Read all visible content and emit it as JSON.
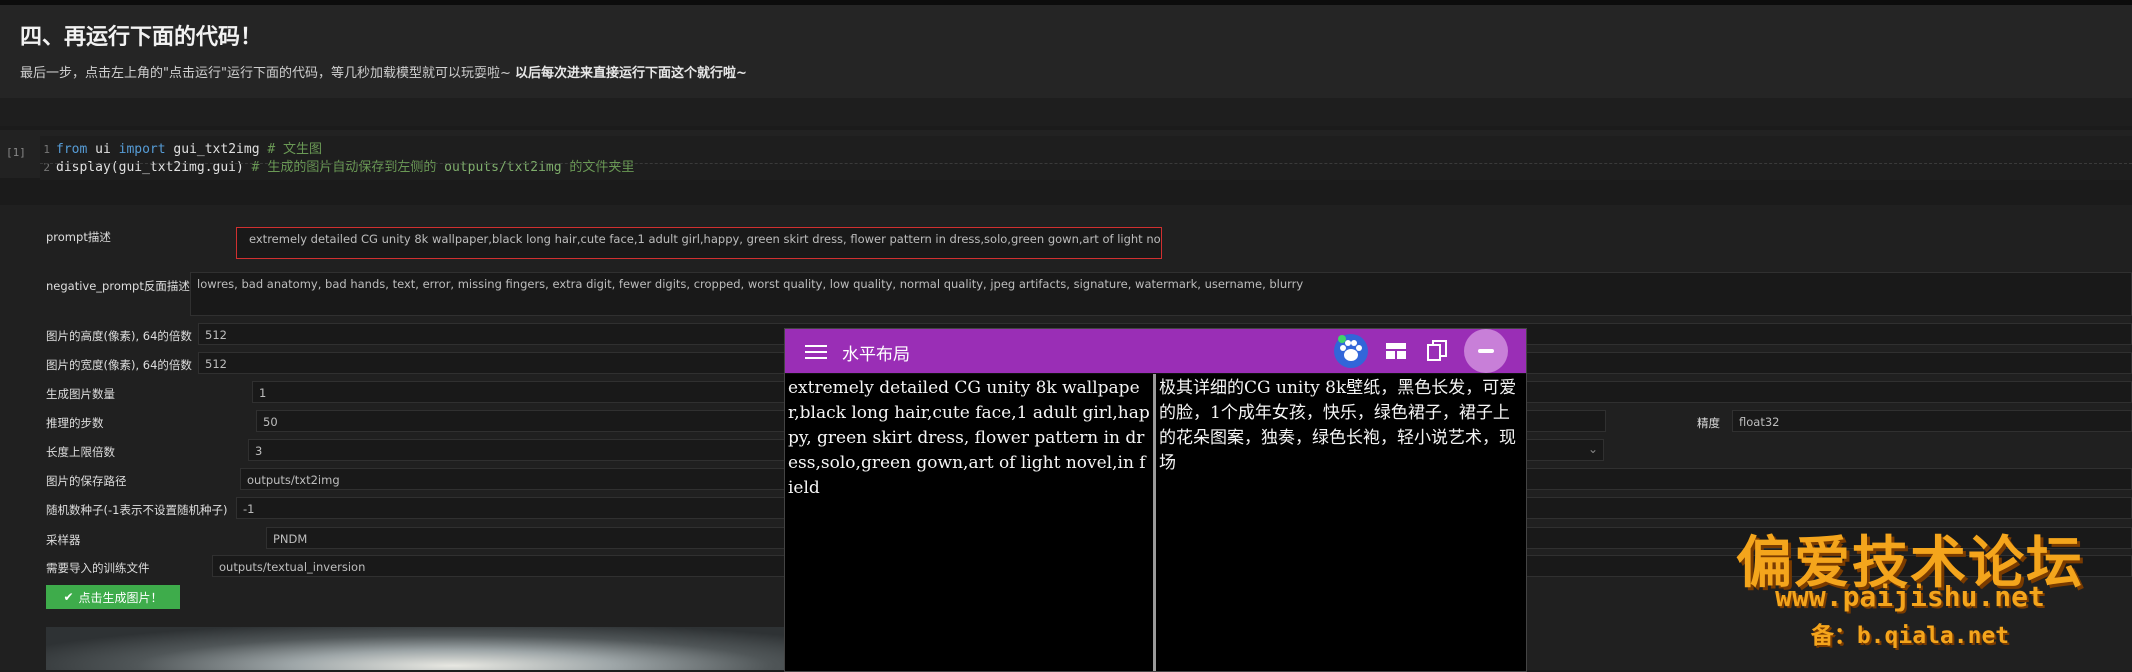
{
  "markdown": {
    "title": "四、再运行下面的代码！",
    "text": "最后一步，点击左上角的\"点击运行\"运行下面的代码，等几秒加载模型就可以玩耍啦~",
    "text_bold": "以后每次进来直接运行下面这个就行啦~"
  },
  "code_cell": {
    "exec_count": "[1]",
    "line1": {
      "num": "1",
      "kw1": "from",
      "mod": "ui",
      "kw2": "import",
      "name": "gui_txt2img",
      "comment": "# 文生图"
    },
    "line2": {
      "num": "2",
      "code": "display(gui_txt2img.gui)",
      "comment": "# 生成的图片自动保存到左侧的",
      "path": "outputs/txt2img",
      "comment2": "的文件夹里"
    }
  },
  "form": {
    "prompt": {
      "label": "prompt描述",
      "value": "extremely detailed CG unity 8k wallpaper,black long hair,cute face,1 adult girl,happy, green skirt dress, flower pattern in dress,solo,green gown,art of light novel,in field"
    },
    "negative_prompt": {
      "label": "negative_prompt反面描述",
      "value": "lowres, bad anatomy, bad hands, text, error, missing fingers, extra digit, fewer digits, cropped, worst quality, low quality, normal quality, jpeg artifacts, signature, watermark, username, blurry"
    },
    "height": {
      "label": "图片的高度(像素), 64的倍数",
      "value": "512"
    },
    "width": {
      "label": "图片的宽度(像素), 64的倍数",
      "value": "512"
    },
    "num_images": {
      "label": "生成图片数量",
      "value": "1"
    },
    "steps": {
      "label": "推理的步数",
      "value": "50"
    },
    "precision": {
      "label": "精度",
      "value": "float32"
    },
    "max_len": {
      "label": "长度上限倍数",
      "value": "3"
    },
    "save_path": {
      "label": "图片的保存路径",
      "value": "outputs/txt2img"
    },
    "seed": {
      "label": "随机数种子(-1表示不设置随机种子)",
      "value": "-1"
    },
    "sampler": {
      "label": "采样器",
      "value": "PNDM"
    },
    "textual_inversion": {
      "label": "需要导入的训练文件",
      "value": "outputs/textual_inversion"
    },
    "generate_button": "点击生成图片！"
  },
  "translator": {
    "title": "水平布局",
    "source_text": "extremely detailed CG unity 8k wallpaper,black long hair,cute face,1 adult girl,happy, green skirt dress, flower pattern in dress,solo,green gown,art of light novel,in field",
    "translated_text": "极其详细的CG unity 8k壁纸，黑色长发，可爱的脸，1个成年女孩，快乐，绿色裙子，裙子上的花朵图案，独奏，绿色长袍，轻小说艺术，现场",
    "header_color": "#9a2eb6"
  },
  "watermark": {
    "line1": "偏爱技术论坛",
    "line2": "www.paijishu.net",
    "line3": "备：b.qiala.net"
  }
}
